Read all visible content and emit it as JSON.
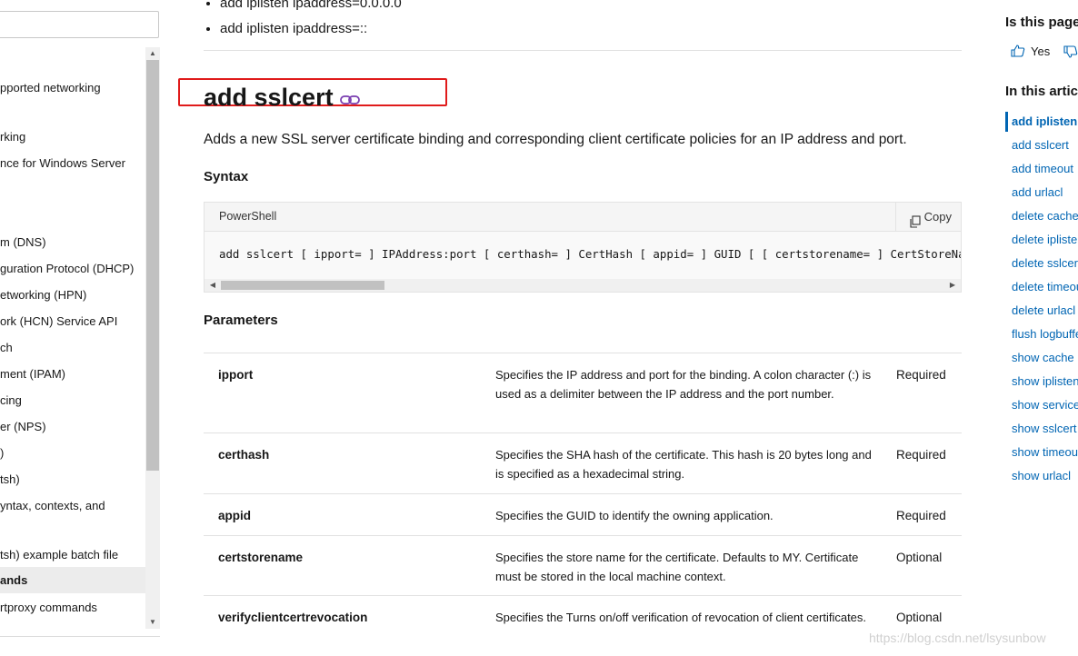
{
  "left_nav": {
    "items": [
      "pported networking",
      "rking",
      "nce for Windows Server",
      "m (DNS)",
      "guration Protocol (DHCP)",
      "etworking (HPN)",
      "ork (HCN) Service API",
      "ch",
      "ment (IPAM)",
      "cing",
      "er (NPS)",
      ")",
      "tsh)",
      "yntax, contexts, and",
      "tsh) example batch file",
      "ands",
      "rtproxy commands"
    ],
    "active_index": 15
  },
  "top_list": [
    "add iplisten ipaddress=0.0.0.0",
    "add iplisten ipaddress=::"
  ],
  "section": {
    "title": "add sslcert",
    "description": "Adds a new SSL server certificate binding and corresponding client certificate policies for an IP address and port.",
    "syntax_heading": "Syntax",
    "code": {
      "language": "PowerShell",
      "copy_label": "Copy",
      "line": "add sslcert [ ipport= ] IPAddress:port [ certhash= ] CertHash [ appid= ] GUID [ [ certstorename= ] CertStoreName [ verifyclientcertrevocation= ] enable | disable"
    },
    "parameters_heading": "Parameters",
    "parameters": [
      {
        "name": "ipport",
        "desc": "Specifies the IP address and port for the binding. A colon character (:) is used as a delimiter between the IP address and the port number.",
        "req": "Required"
      },
      {
        "name": "certhash",
        "desc": "Specifies the SHA hash of the certificate. This hash is 20 bytes long and is specified as a hexadecimal string.",
        "req": "Required"
      },
      {
        "name": "appid",
        "desc": "Specifies the GUID to identify the owning application.",
        "req": "Required"
      },
      {
        "name": "certstorename",
        "desc": "Specifies the store name for the certificate. Defaults to MY. Certificate must be stored in the local machine context.",
        "req": "Optional"
      },
      {
        "name": "verifyclientcertrevocation",
        "desc": "Specifies the Turns on/off verification of revocation of client certificates.",
        "req": "Optional"
      }
    ]
  },
  "right_rail": {
    "feedback_question": "Is this page",
    "yes_label": "Yes",
    "in_this_article": "In this artic",
    "links": [
      "add iplisten",
      "add sslcert",
      "add timeout",
      "add urlacl",
      "delete cache",
      "delete iplisten",
      "delete sslcert",
      "delete timeout",
      "delete urlacl",
      "flush logbuffer",
      "show cache",
      "show iplisten",
      "show service",
      "show sslcert",
      "show timeout",
      "show urlacl"
    ],
    "active_index": 0
  },
  "watermark": "https://blog.csdn.net/lsysunbow",
  "colors": {
    "link": "#0065b3",
    "highlight_border": "#e01b1b",
    "text": "#171717"
  }
}
